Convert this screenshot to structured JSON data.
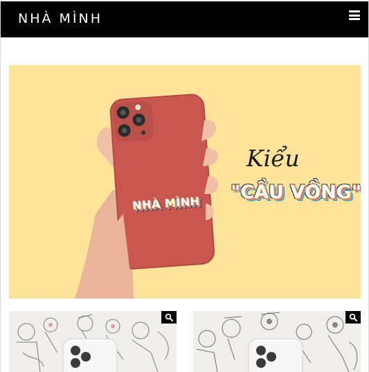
{
  "site": {
    "brand": "NHÀ MÌNH",
    "menu_icon": "hamburger-menu-icon"
  },
  "hero": {
    "title": "Kiểu",
    "subtitle": "\"CẦU VỒNG\"",
    "case_label": "NHÀ MÌNH",
    "background": "#fde49a",
    "phone_color": "#c9574f"
  },
  "products": [
    {
      "zoom_icon": "search-icon"
    },
    {
      "zoom_icon": "search-icon"
    }
  ]
}
